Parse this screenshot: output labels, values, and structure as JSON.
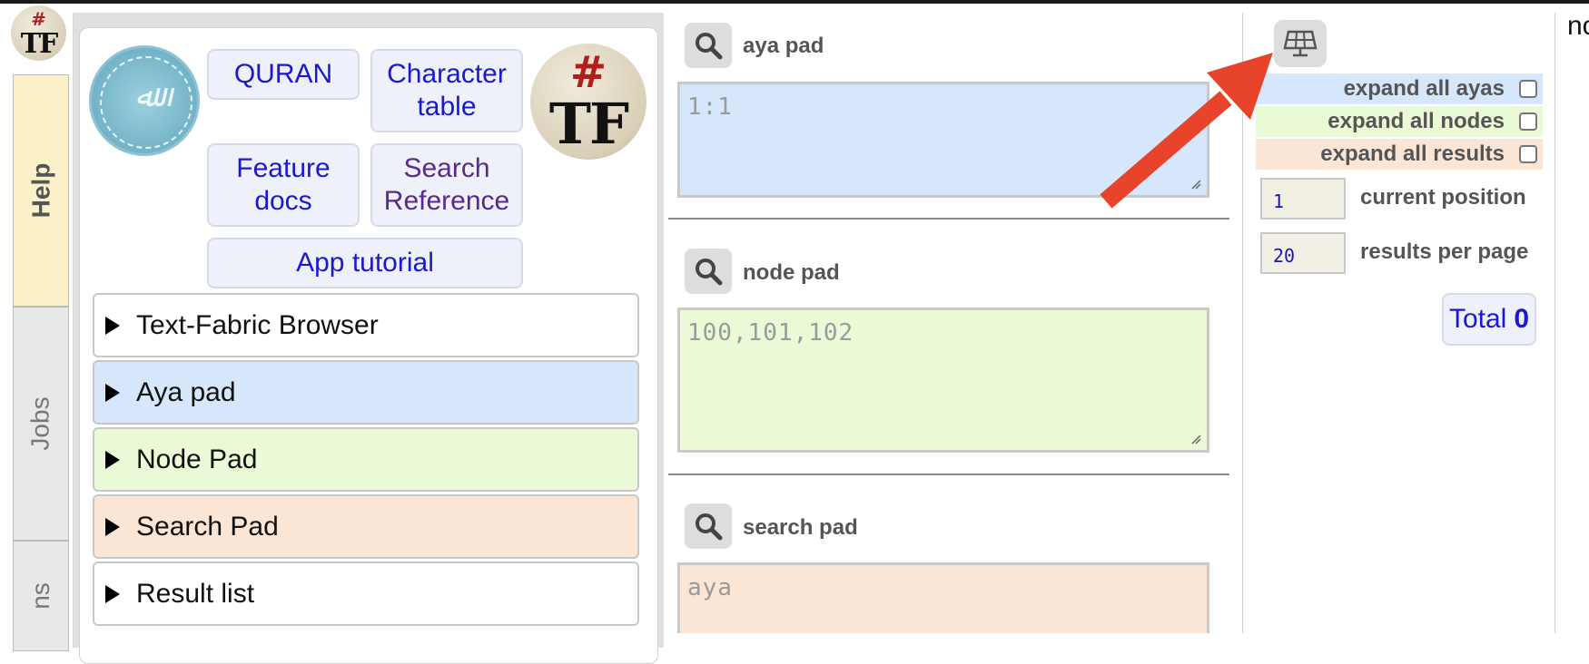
{
  "left_tabs": {
    "help": "Help",
    "jobs": "Jobs",
    "third": "ns"
  },
  "help_panel": {
    "links": {
      "quran": "QURAN",
      "character_table_1": "Character",
      "character_table_2": "table",
      "feature_docs_1": "Feature",
      "feature_docs_2": "docs",
      "search_reference_1": "Search",
      "search_reference_2": "Reference",
      "app_tutorial": "App tutorial"
    },
    "sections": [
      {
        "label": "Text-Fabric Browser",
        "color": "#ffffff"
      },
      {
        "label": "Aya pad",
        "color": "#d6e6fb"
      },
      {
        "label": "Node Pad",
        "color": "#ebfad6"
      },
      {
        "label": "Search Pad",
        "color": "#fbe6d6"
      },
      {
        "label": "Result list",
        "color": "#ffffff"
      }
    ]
  },
  "pads": {
    "aya": {
      "title": "aya pad",
      "placeholder": "1:1",
      "color": "#d6e6fb"
    },
    "node": {
      "title": "node pad",
      "placeholder": "100,101,102",
      "color": "#ebfad6"
    },
    "search": {
      "title": "search pad",
      "placeholder": "aya",
      "color": "#fbe6d6"
    }
  },
  "options": {
    "expand_ayas": {
      "label": "expand all ayas",
      "color": "#d6e6fb"
    },
    "expand_nodes": {
      "label": "expand all nodes",
      "color": "#ebfad6"
    },
    "expand_results": {
      "label": "expand all results",
      "color": "#fbe6d6"
    },
    "current_position": {
      "label": "current position",
      "value": "1"
    },
    "results_per_page": {
      "label": "results per page",
      "value": "20"
    },
    "total": {
      "label": "Total",
      "value": "0"
    }
  },
  "edge_text": "nc",
  "annotation": {
    "arrow_color": "#e8432b"
  }
}
